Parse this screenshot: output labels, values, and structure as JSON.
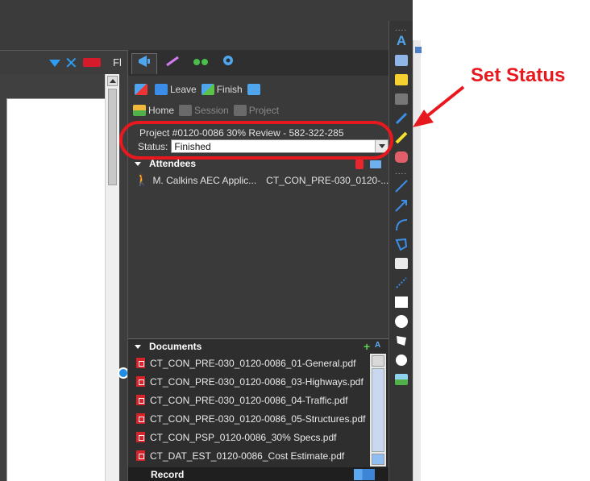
{
  "tabstrip": {
    "fl_text": "Fl"
  },
  "panel": {
    "tabs": [
      "bullhorn-icon",
      "ruler-icon",
      "binoculars-icon",
      "gear-icon"
    ],
    "session_row": {
      "leave_label": "Leave",
      "finish_label": "Finish"
    },
    "nav_row": {
      "home_label": "Home",
      "session_label": "Session",
      "project_label": "Project"
    },
    "project_line": "Project #0120-0086 30% Review - 582-322-285",
    "status": {
      "label": "Status:",
      "value": "Finished"
    },
    "attendees": {
      "header": "Attendees",
      "items": [
        {
          "name": "M. Calkins AEC Applic...",
          "document": "CT_CON_PRE-030_0120-..."
        }
      ]
    },
    "documents": {
      "header": "Documents",
      "sort_label": "A",
      "items": [
        "CT_CON_PRE-030_0120-0086_01-General.pdf",
        "CT_CON_PRE-030_0120-0086_03-Highways.pdf",
        "CT_CON_PRE-030_0120-0086_04-Traffic.pdf",
        "CT_CON_PRE-030_0120-0086_05-Structures.pdf",
        "CT_CON_PSP_0120-0086_30% Specs.pdf",
        "CT_DAT_EST_0120-0086_Cost Estimate.pdf"
      ]
    },
    "record": {
      "header": "Record"
    }
  },
  "toolstrip": {
    "text_tool_label": "A"
  },
  "annotation": {
    "callout": "Set Status"
  },
  "colors": {
    "accent": "#2e9cf2",
    "annotation_red": "#e8191e",
    "panel_bg": "#3a3a3a"
  }
}
